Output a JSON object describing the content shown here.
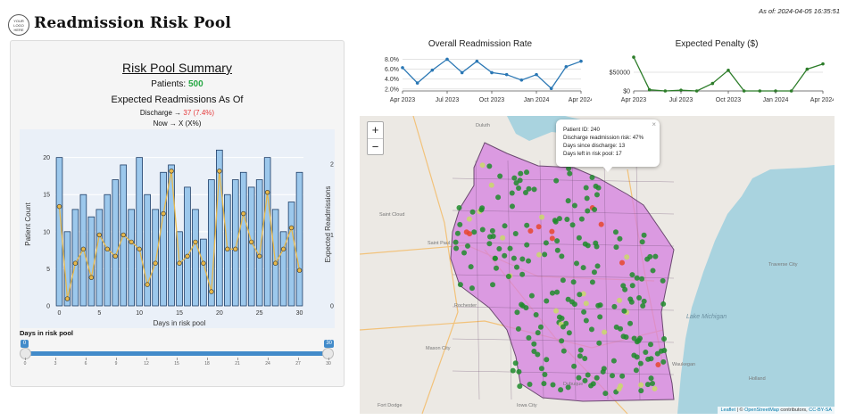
{
  "header": {
    "logo_text": "YOUR LOGO HERE",
    "title": "Readmission Risk Pool",
    "as_of": "As of: 2024-04-05 16:35:51"
  },
  "summary": {
    "title": "Risk Pool Summary",
    "patients_label": "Patients:",
    "patients_value": "500",
    "expected_heading": "Expected Readmissions As Of",
    "discharge_label": "Discharge →",
    "discharge_value": "37 (7.4%)",
    "now_text": "Now → X (X%)",
    "colors": {
      "patients": "#27a845",
      "discharge": "#e5393b"
    }
  },
  "slider": {
    "label": "Days in risk pool",
    "min": 0,
    "max": 30,
    "selected_low": "0",
    "selected_high": "30",
    "tick_labels": [
      "0",
      "3",
      "6",
      "9",
      "12",
      "15",
      "18",
      "21",
      "24",
      "27",
      "30"
    ]
  },
  "chart_data": [
    {
      "type": "bar",
      "xlabel": "Days in risk pool",
      "ylabel": "Patient Count",
      "y2label": "Expected Readmissions",
      "x_ticks": [
        "0",
        "5",
        "10",
        "15",
        "20",
        "25",
        "30"
      ],
      "y_ticks": [
        "0",
        "5",
        "10",
        "15",
        "20"
      ],
      "y2_ticks": [
        "0",
        "1",
        "2"
      ],
      "ylim": [
        0,
        22
      ],
      "y2lim": [
        0,
        2.3
      ],
      "x": [
        0,
        1,
        2,
        3,
        4,
        5,
        6,
        7,
        8,
        9,
        10,
        11,
        12,
        13,
        14,
        15,
        16,
        17,
        18,
        19,
        20,
        21,
        22,
        23,
        24,
        25,
        26,
        27,
        28,
        29,
        30
      ],
      "series": [
        {
          "name": "Patient Count",
          "axis": "left",
          "values": [
            20,
            10,
            13,
            15,
            12,
            13,
            15,
            17,
            19,
            13,
            20,
            15,
            13,
            18,
            19,
            10,
            16,
            13,
            9,
            17,
            21,
            15,
            17,
            18,
            16,
            17,
            20,
            13,
            10,
            14,
            18
          ],
          "color": "#9cc8ec"
        },
        {
          "name": "Expected Readmissions",
          "axis": "right",
          "values": [
            1.4,
            0.1,
            0.6,
            0.8,
            0.4,
            1.0,
            0.8,
            0.7,
            1.0,
            0.9,
            0.8,
            0.3,
            0.6,
            1.3,
            1.9,
            0.6,
            0.7,
            0.9,
            0.6,
            0.2,
            1.9,
            0.8,
            0.8,
            1.3,
            0.9,
            0.7,
            1.6,
            0.6,
            0.8,
            1.1,
            0.5
          ],
          "color": "#e8b94b"
        }
      ]
    },
    {
      "type": "line",
      "title": "Overall Readmission Rate",
      "x": [
        "2023-04",
        "2023-05",
        "2023-06",
        "2023-07",
        "2023-08",
        "2023-09",
        "2023-10",
        "2023-11",
        "2023-12",
        "2024-01",
        "2024-02",
        "2024-03",
        "2024-04"
      ],
      "x_ticks": [
        "Apr 2023",
        "Jul 2023",
        "Oct 2023",
        "Jan 2024",
        "Apr 2024"
      ],
      "y_ticks": [
        "2.0%",
        "4.0%",
        "6.0%",
        "8.0%"
      ],
      "ylim": [
        1.6,
        8.8
      ],
      "values": [
        6.3,
        3.2,
        5.8,
        8.0,
        5.3,
        7.6,
        5.3,
        4.9,
        3.8,
        4.9,
        2.1,
        6.5,
        7.6
      ],
      "color": "#2a77b4"
    },
    {
      "type": "line",
      "title": "Expected Penalty ($)",
      "x": [
        "2023-04",
        "2023-05",
        "2023-06",
        "2023-07",
        "2023-08",
        "2023-09",
        "2023-10",
        "2023-11",
        "2023-12",
        "2024-01",
        "2024-02",
        "2024-03",
        "2024-04"
      ],
      "x_ticks": [
        "Apr 2023",
        "Jul 2023",
        "Oct 2023",
        "Jan 2024",
        "Apr 2024"
      ],
      "y_ticks": [
        "$0",
        "$50000"
      ],
      "ylim": [
        0,
        95000
      ],
      "values": [
        90000,
        3000,
        0,
        2000,
        0,
        20000,
        55000,
        0,
        0,
        0,
        0,
        58000,
        72000
      ],
      "color": "#2d7d2a"
    }
  ],
  "map": {
    "zoom_in": "+",
    "zoom_out": "−",
    "popup": {
      "close": "×",
      "lines": [
        "Patient ID: 240",
        "Discharge readmission risk: 47%",
        "Days since discharge: 13",
        "Days left in risk pool: 17"
      ]
    },
    "attribution": {
      "leaflet": "Leaflet",
      "sep": " | © ",
      "osm": "OpenStreetMap",
      "contrib": " contributors, ",
      "license": "CC-BY-SA"
    },
    "place_labels": [
      "Duluth",
      "Saint Cloud",
      "Saint Paul",
      "Rochester",
      "Mason City",
      "Fort Dodge",
      "Lake Michigan",
      "Traverse City",
      "Holland",
      "Dubuque",
      "Iowa City",
      "Waukegan"
    ],
    "colors": {
      "state_fill": "#d57fe0",
      "low_risk": "#1e8b2c",
      "mid_risk": "#c9d96a",
      "high_risk": "#e6462d",
      "water": "#a9d3df",
      "land": "#ece9e4"
    }
  }
}
